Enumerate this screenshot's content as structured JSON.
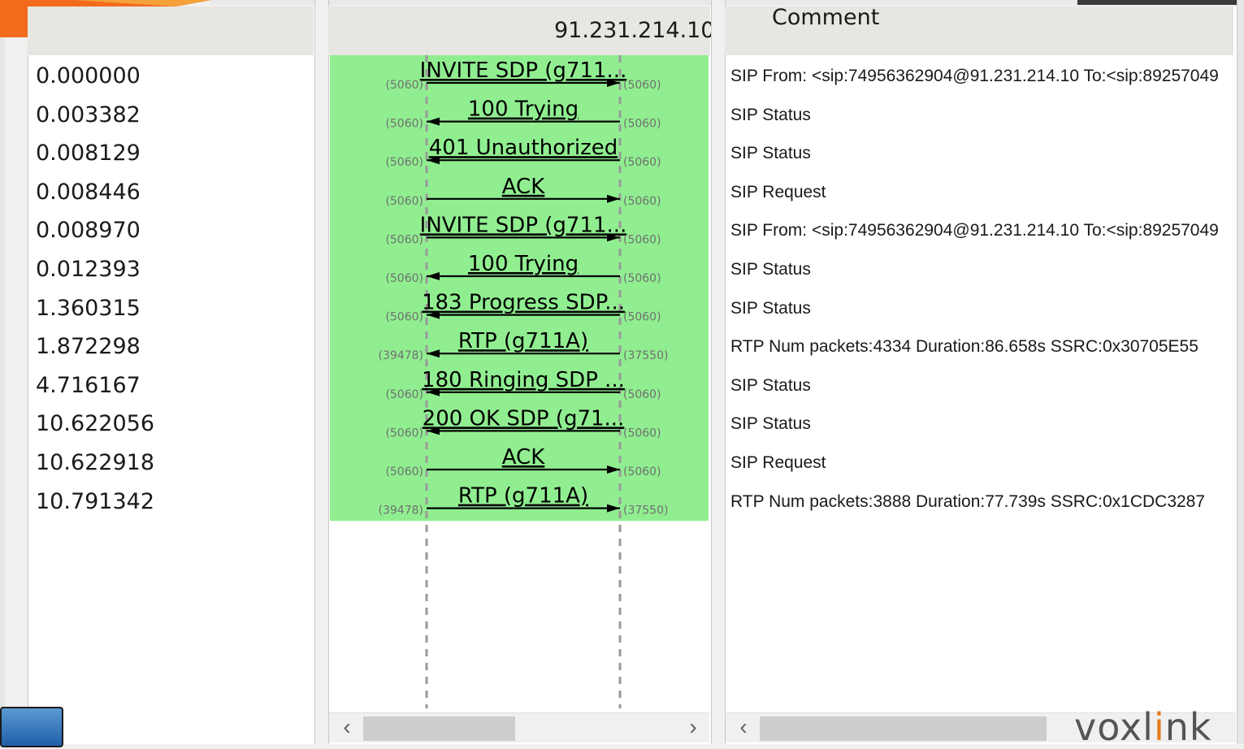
{
  "window": {
    "host_ip": "91.231.214.10",
    "comment_header": "Comment"
  },
  "rows": [
    {
      "time": "0.000000",
      "label": "INVITE SDP (g711...",
      "src_port": "(5060)",
      "dst_port": "(5060)",
      "dir": "right",
      "comment": "SIP From: <sip:74956362904@91.231.214.10 To:<sip:89257049"
    },
    {
      "time": "0.003382",
      "label": "100 Trying",
      "src_port": "(5060)",
      "dst_port": "(5060)",
      "dir": "left",
      "comment": "SIP Status"
    },
    {
      "time": "0.008129",
      "label": "401 Unauthorized",
      "src_port": "(5060)",
      "dst_port": "(5060)",
      "dir": "left",
      "comment": "SIP Status"
    },
    {
      "time": "0.008446",
      "label": "ACK",
      "src_port": "(5060)",
      "dst_port": "(5060)",
      "dir": "right",
      "comment": "SIP Request"
    },
    {
      "time": "0.008970",
      "label": "INVITE SDP (g711...",
      "src_port": "(5060)",
      "dst_port": "(5060)",
      "dir": "right",
      "comment": "SIP From: <sip:74956362904@91.231.214.10 To:<sip:89257049"
    },
    {
      "time": "0.012393",
      "label": "100 Trying",
      "src_port": "(5060)",
      "dst_port": "(5060)",
      "dir": "left",
      "comment": "SIP Status"
    },
    {
      "time": "1.360315",
      "label": "183 Progress SDP...",
      "src_port": "(5060)",
      "dst_port": "(5060)",
      "dir": "left",
      "comment": "SIP Status"
    },
    {
      "time": "1.872298",
      "label": "RTP (g711A)",
      "src_port": "(39478)",
      "dst_port": "(37550)",
      "dir": "left",
      "comment": "RTP Num packets:4334  Duration:86.658s SSRC:0x30705E55"
    },
    {
      "time": "4.716167",
      "label": "180 Ringing SDP ...",
      "src_port": "(5060)",
      "dst_port": "(5060)",
      "dir": "left",
      "comment": "SIP Status"
    },
    {
      "time": "10.622056",
      "label": "200 OK SDP (g71...",
      "src_port": "(5060)",
      "dst_port": "(5060)",
      "dir": "left",
      "comment": "SIP Status"
    },
    {
      "time": "10.622918",
      "label": "ACK",
      "src_port": "(5060)",
      "dst_port": "(5060)",
      "dir": "right",
      "comment": "SIP Request"
    },
    {
      "time": "10.791342",
      "label": "RTP (g711A)",
      "src_port": "(39478)",
      "dst_port": "(37550)",
      "dir": "right",
      "comment": "RTP Num packets:3888  Duration:77.739s SSRC:0x1CDC3287"
    }
  ],
  "scroll": {
    "left_arrow": "‹",
    "right_arrow": "›"
  },
  "logo": {
    "text_main": "voxl",
    "text_accent": "i",
    "text_end": "nk"
  },
  "colors": {
    "highlight": "#90ee90",
    "orange": "#f26b1d"
  }
}
